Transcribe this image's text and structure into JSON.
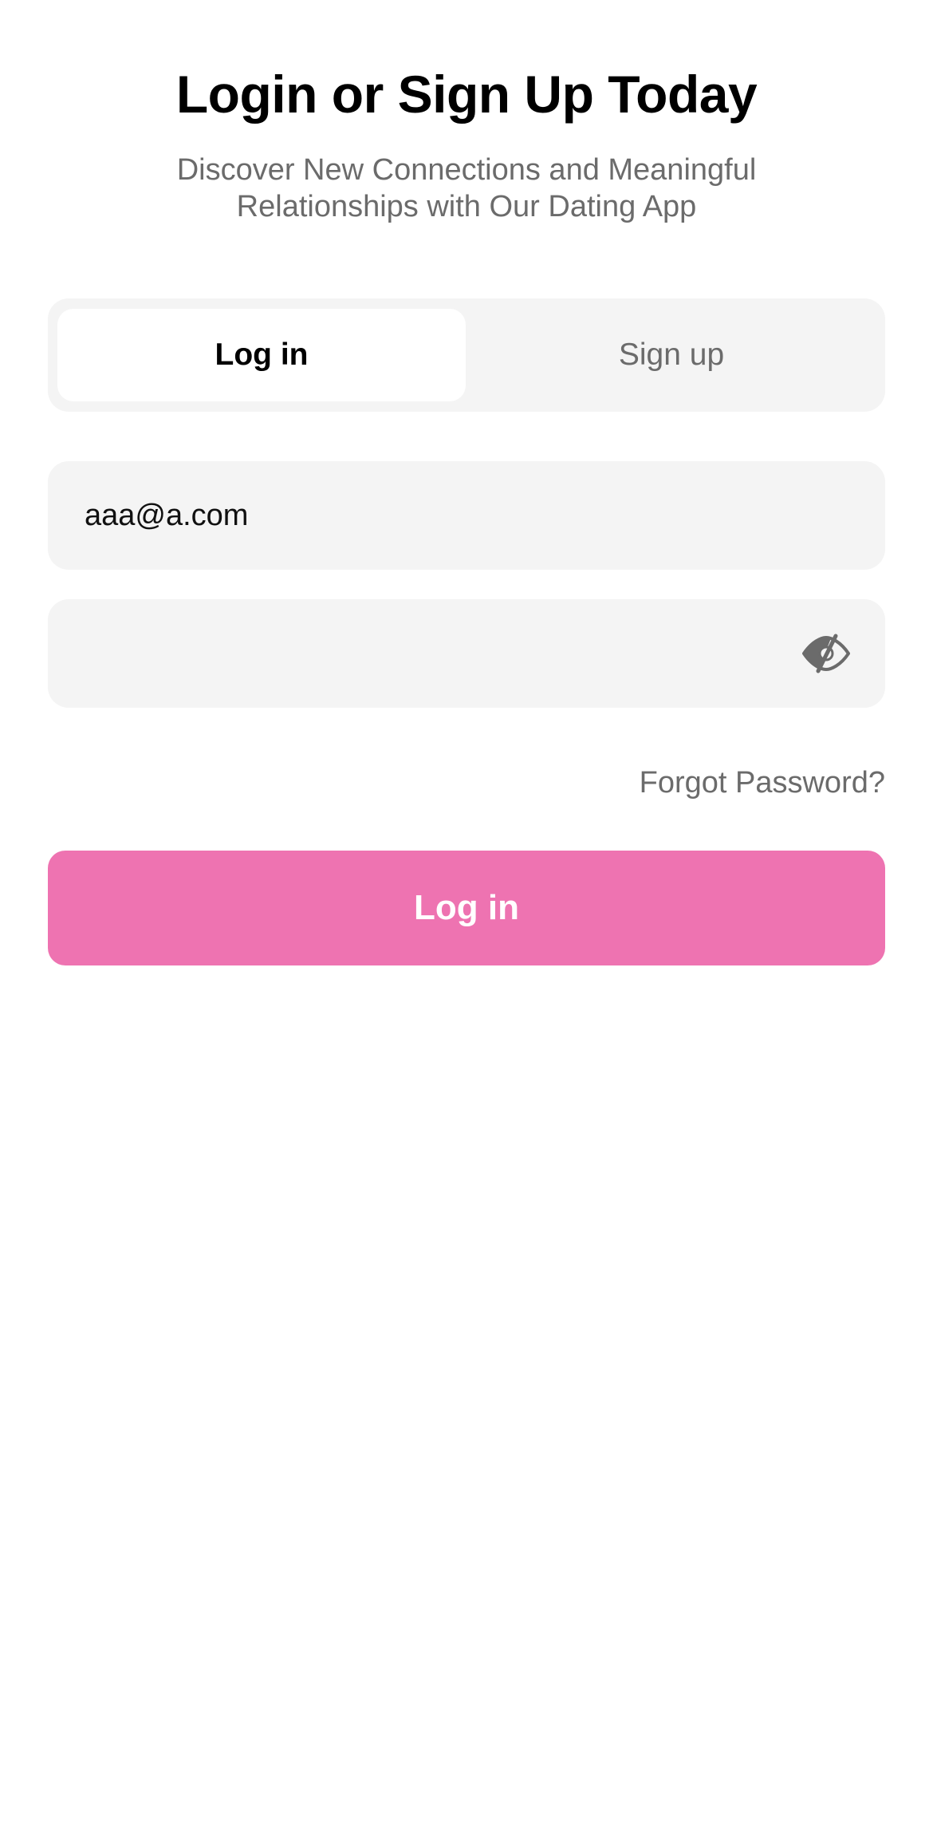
{
  "header": {
    "title": "Login or Sign Up Today",
    "subtitle": "Discover New Connections and Meaningful Relationships with Our Dating App"
  },
  "tabs": [
    {
      "label": "Log in",
      "active": true
    },
    {
      "label": "Sign up",
      "active": false
    }
  ],
  "form": {
    "email_value": "aaa@a.com",
    "password_value": "",
    "password_toggle_icon": "eye-slash-icon",
    "forgot_label": "Forgot Password?",
    "submit_label": "Log in"
  },
  "colors": {
    "accent": "#ee73b1",
    "field_bg": "#f4f4f4",
    "muted_text": "#6b6b6b"
  }
}
